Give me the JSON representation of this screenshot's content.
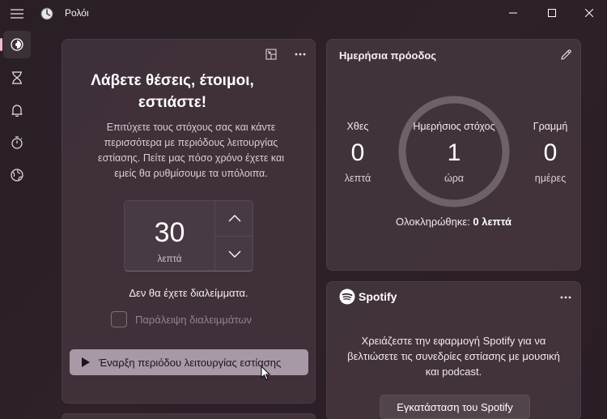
{
  "window": {
    "title": "Ρολόι"
  },
  "nav": {
    "items": [
      {
        "icon": "focus-sessions-icon",
        "active": true
      },
      {
        "icon": "timer-icon",
        "active": false
      },
      {
        "icon": "alarm-icon",
        "active": false
      },
      {
        "icon": "stopwatch-icon",
        "active": false
      },
      {
        "icon": "world-clock-icon",
        "active": false
      }
    ]
  },
  "focus": {
    "title_line1": "Λάβετε θέσεις, έτοιμοι,",
    "title_line2": "εστιάστε!",
    "description": "Επιτύχετε τους στόχους σας και κάντε περισσότερα με περιόδους λειτουργίας εστίασης. Πείτε μας πόσο χρόνο έχετε και εμείς θα ρυθμίσουμε τα υπόλοιπα.",
    "timer_value": "30",
    "timer_unit": "λεπτά",
    "no_breaks": "Δεν θα έχετε διαλείμματα.",
    "skip_breaks_label": "Παράλειψη διαλειμμάτων",
    "skip_breaks_checked": false,
    "start_label": "Έναρξη περιόδου λειτουργίας εστίασης"
  },
  "progress": {
    "title": "Ημερήσια πρόοδος",
    "yesterday": {
      "label": "Χθες",
      "value": "0",
      "unit": "λεπτά"
    },
    "goal": {
      "label": "Ημερήσιος στόχος",
      "value": "1",
      "unit": "ώρα"
    },
    "streak": {
      "label": "Γραμμή",
      "value": "0",
      "unit": "ημέρες"
    },
    "completed_label": "Ολοκληρώθηκε:",
    "completed_value": "0 λεπτά",
    "goal_fraction": 0
  },
  "spotify": {
    "brand": "Spotify",
    "text": "Χρειάζεστε την εφαρμογή Spotify για να βελτιώσετε τις συνεδρίες εστίασης με μουσική και podcast.",
    "install_label": "Εγκατάσταση του Spotify"
  },
  "colors": {
    "accent": "#f0b9cc",
    "start_button": "#a79aa6"
  }
}
